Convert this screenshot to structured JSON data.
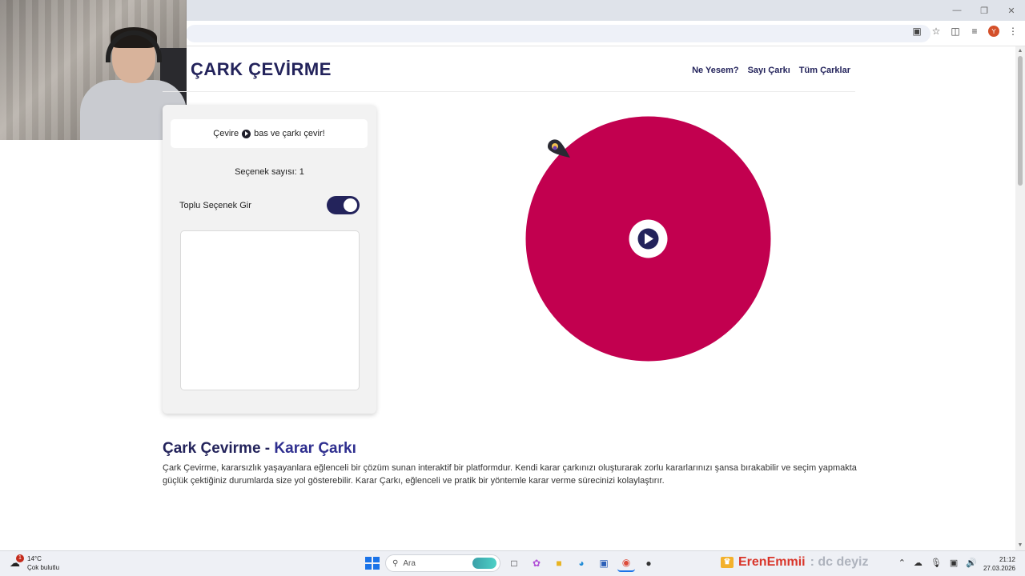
{
  "site": {
    "title": "ÇARK ÇEVİRME",
    "nav": [
      "Ne Yesem?",
      "Sayı Çarkı",
      "Tüm Çarklar"
    ]
  },
  "panel": {
    "info_prefix": "Çevire",
    "info_suffix": "bas ve çarkı çevir!",
    "count_label": "Seçenek sayısı: 1",
    "toggle_label": "Toplu Seçenek Gir",
    "toggle_on": true,
    "textarea_value": ""
  },
  "wheel": {
    "color": "#c2004f",
    "center_bg": "#ffffff",
    "play_color": "#23235b",
    "pointer_color": "#2a2a33"
  },
  "article": {
    "title_part1": "Çark Çevirme - ",
    "title_part2": "Karar Çarkı",
    "body": "Çark Çevirme, kararsızlık yaşayanlara eğlenceli bir çözüm sunan interaktif bir platformdur. Kendi karar çarkınızı oluşturarak zorlu kararlarınızı şansa bırakabilir ve seçim yapmakta güçlük çektiğiniz durumlarda size yol gösterebilir. Karar Çarkı, eğlenceli ve pratik bir yöntemle karar verme sürecinizi kolaylaştırır."
  },
  "browser": {
    "avatar_letter": "Y"
  },
  "taskbar": {
    "weather_temp": "14°C",
    "weather_desc": "Çok bulutlu",
    "weather_badge": "1",
    "search_label": "Ara",
    "stream_name": "ErenEmmii",
    "stream_msg": ": dc deyiz",
    "time": "21:12",
    "date": "27.03.2026"
  },
  "colors": {
    "brand": "#23235b",
    "wheel": "#c2004f"
  }
}
